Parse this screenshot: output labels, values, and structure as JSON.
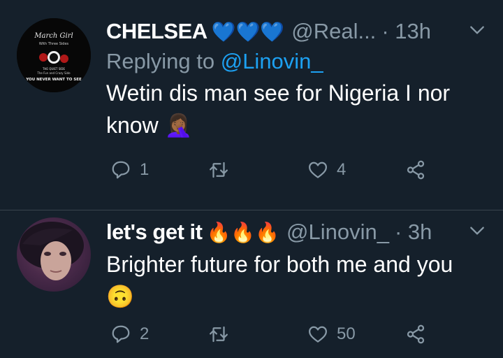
{
  "tweets": [
    {
      "name": "CHELSEA",
      "name_emoji": "💙💙💙",
      "handle": "@Real...",
      "time": "· 13h",
      "reply_prefix": "Replying to ",
      "reply_handle": "@Linovin_",
      "text": "Wetin dis man see for Nigeria I nor know 🤦🏾‍♀️",
      "avatar_text": [
        "March Girl",
        "With Three Sides",
        "THE QUIET SIDE",
        "The Fun and Crazy Side",
        "YOU NEVER WANT TO SEE"
      ],
      "replies": "1",
      "retweets": "",
      "likes": "4"
    },
    {
      "name": "let's get it",
      "name_emoji": "🔥🔥🔥",
      "handle": "@Linovin_",
      "time": "· 3h",
      "text": "Brighter future for both me and you 🙃",
      "replies": "2",
      "retweets": "",
      "likes": "50"
    }
  ],
  "colors": {
    "background": "#15202b",
    "secondary": "#8899a6",
    "link": "#1da1f2"
  }
}
